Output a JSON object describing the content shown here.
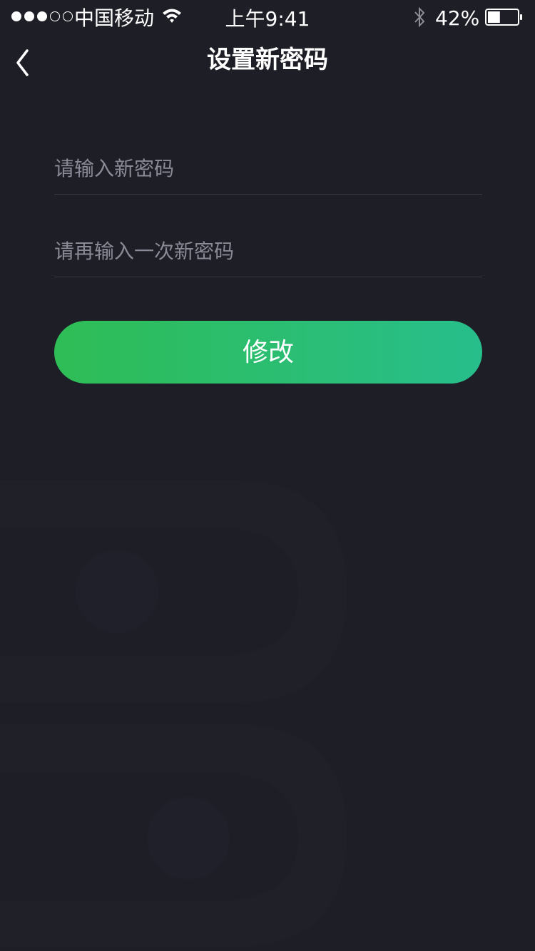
{
  "status_bar": {
    "carrier": "中国移动",
    "time": "上午9:41",
    "battery_percent": "42%",
    "battery_level": 0.42,
    "signal_bars_filled": 3,
    "signal_bars_total": 5,
    "icons": [
      "wifi-icon",
      "bluetooth-icon",
      "battery-icon"
    ]
  },
  "nav": {
    "back_icon": "chevron-left-icon",
    "title": "设置新密码"
  },
  "form": {
    "new_password": {
      "value": "",
      "placeholder": "请输入新密码"
    },
    "confirm_password": {
      "value": "",
      "placeholder": "请再输入一次新密码"
    },
    "submit_label": "修改"
  },
  "colors": {
    "background": "#1e1e26",
    "accent_start": "#2ebd55",
    "accent_end": "#28be8c",
    "placeholder": "#8a8a96",
    "divider": "#383843"
  }
}
